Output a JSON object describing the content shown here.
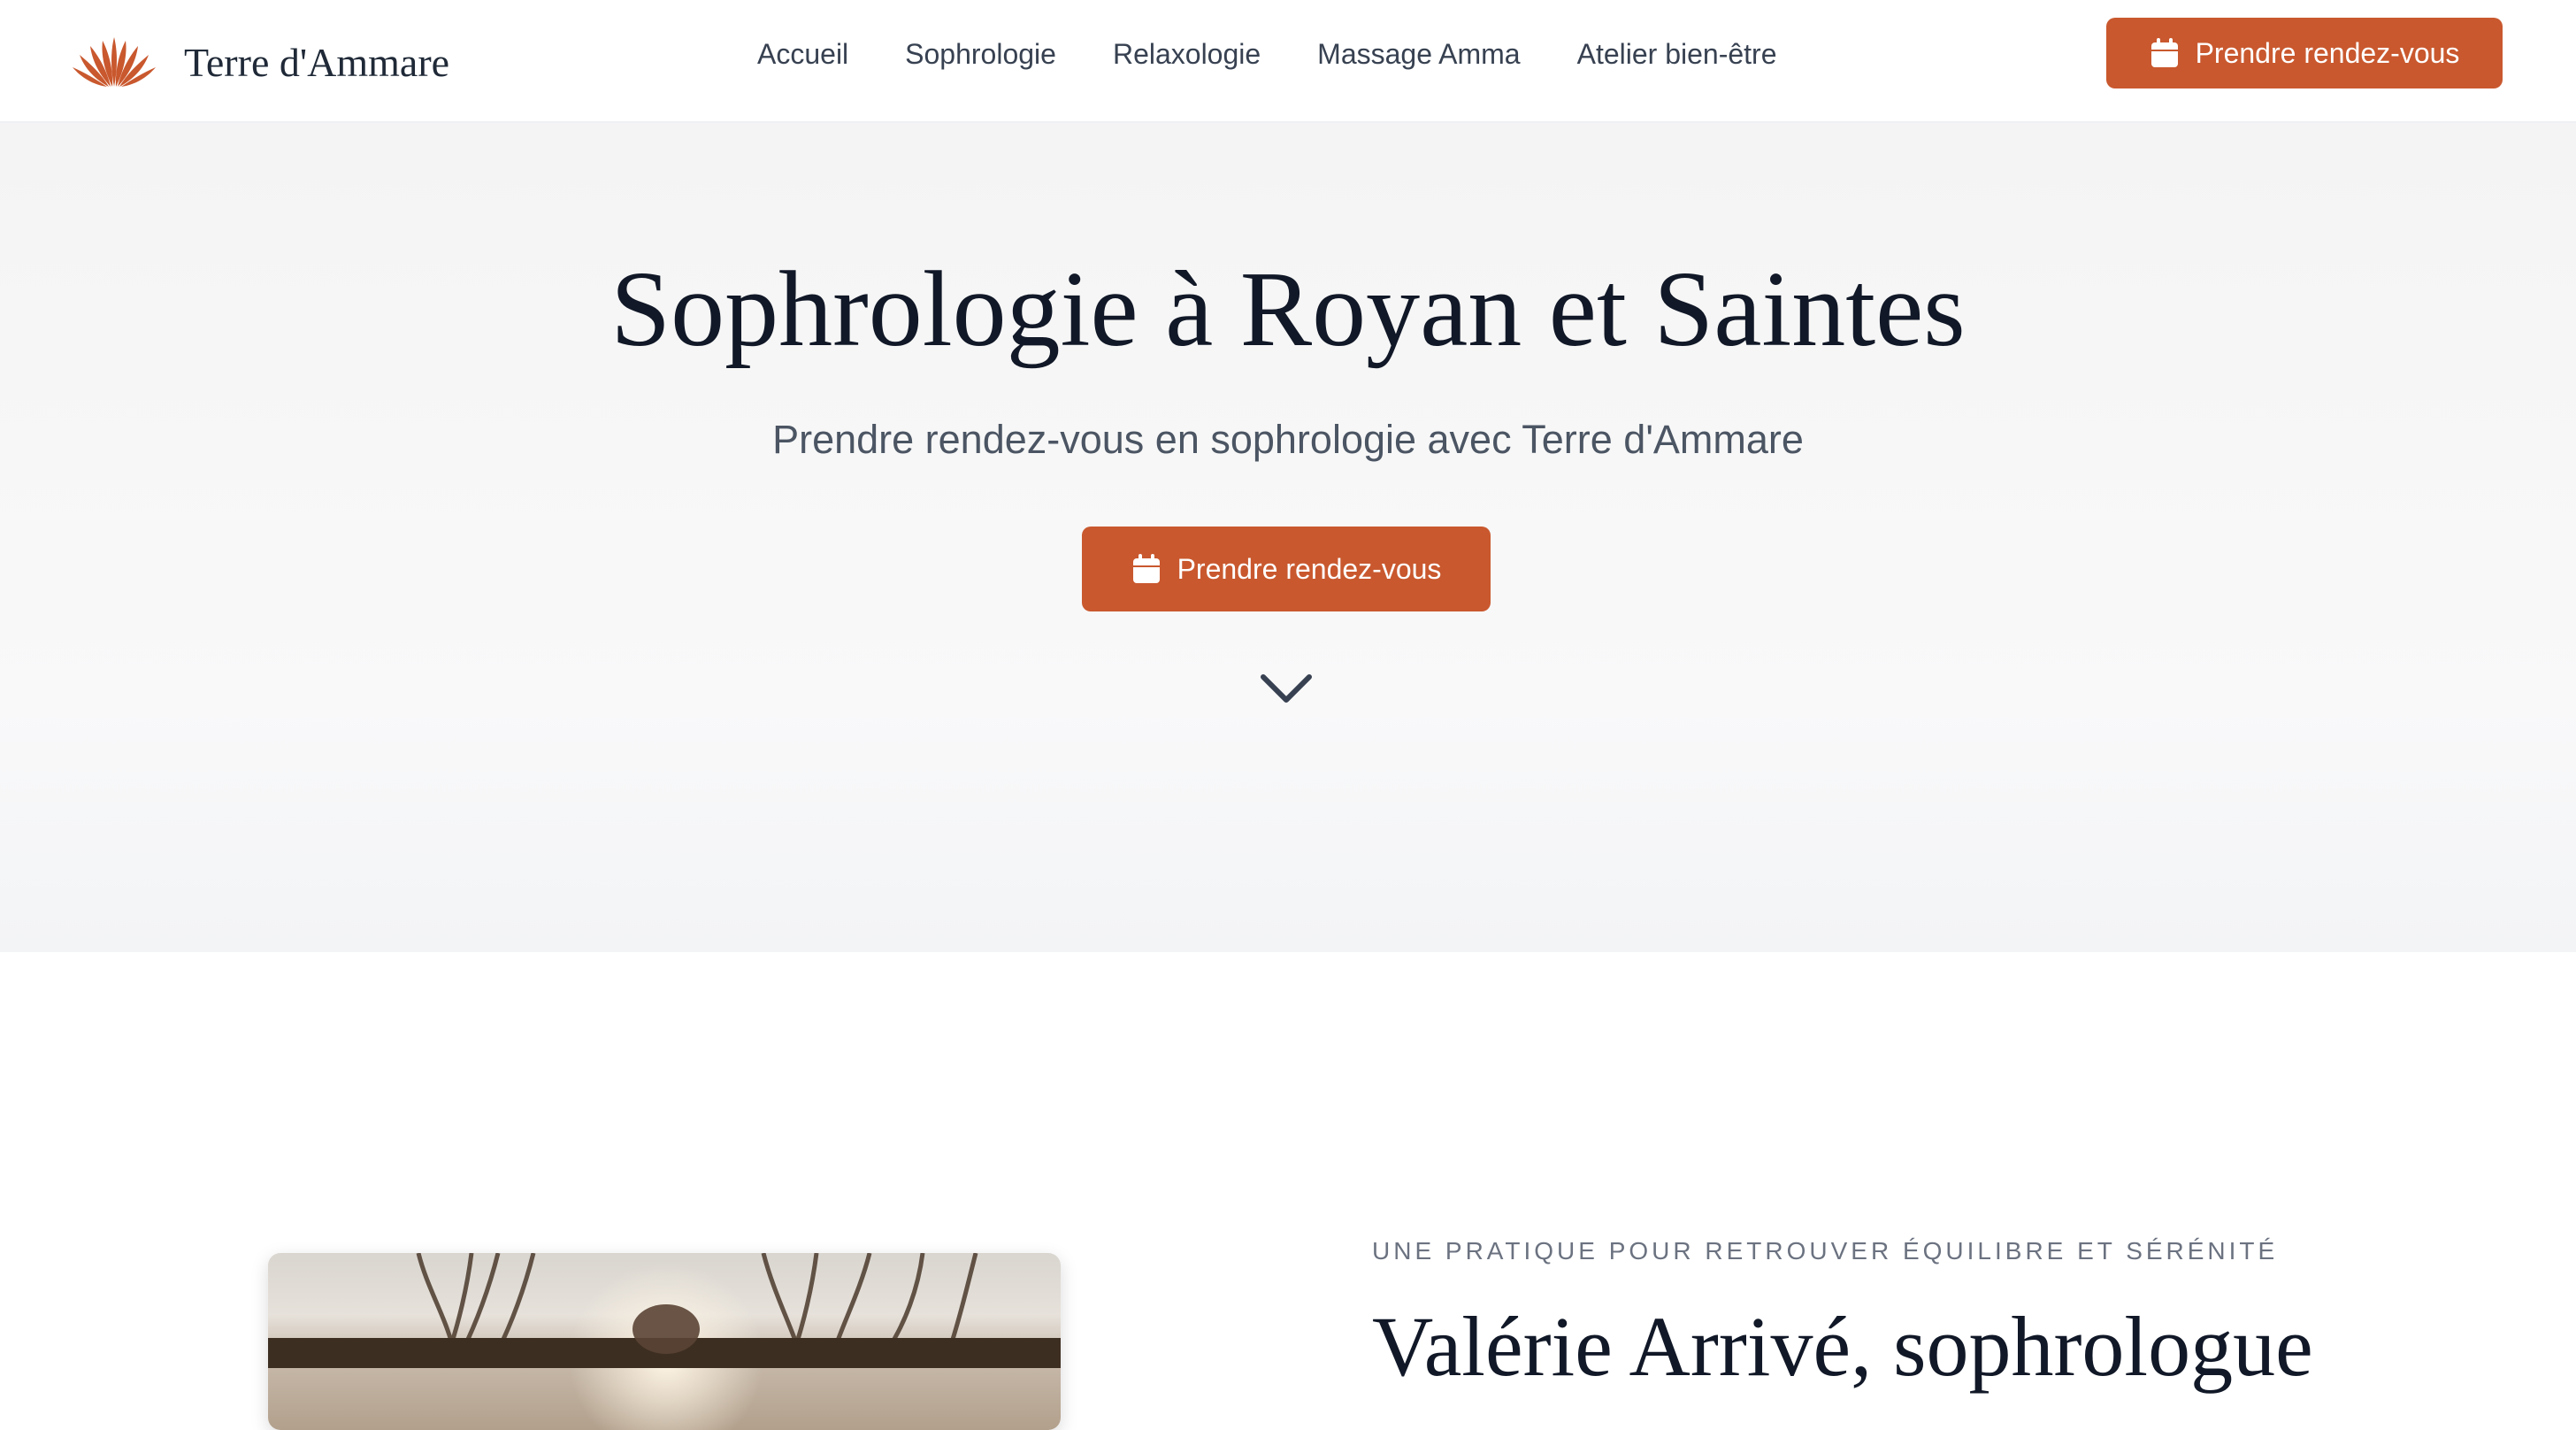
{
  "header": {
    "brand": "Terre d'Ammare",
    "logo_icon": "lotus-icon",
    "nav": [
      "Accueil",
      "Sophrologie",
      "Relaxologie",
      "Massage Amma",
      "Atelier bien-être"
    ],
    "cta_label": "Prendre rendez-vous",
    "cta_icon": "calendar-icon"
  },
  "hero": {
    "title": "Sophrologie à Royan et Saintes",
    "subtitle": "Prendre rendez-vous en sophrologie avec Terre d'Ammare",
    "cta_label": "Prendre rendez-vous",
    "scroll_icon": "chevron-down-icon"
  },
  "about": {
    "eyebrow": "UNE PRATIQUE POUR RETROUVER ÉQUILIBRE ET SÉRÉNITÉ",
    "title": "Valérie Arrivé, sophrologue",
    "image_icon": "palm-sunset-photo"
  },
  "colors": {
    "accent": "#c9582e",
    "text_dark": "#111827",
    "text_muted": "#4b5563",
    "hero_background": "#f5f5f5"
  }
}
